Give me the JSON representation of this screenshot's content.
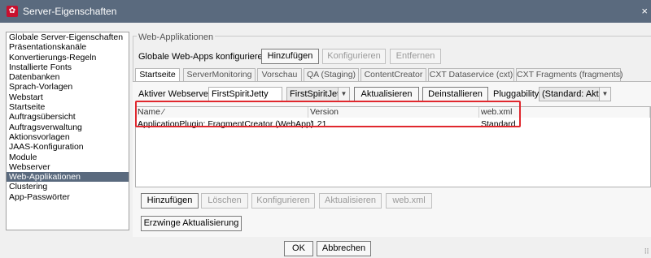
{
  "window": {
    "title": "Server-Eigenschaften",
    "close_glyph": "×",
    "app_icon_glyph": "✿"
  },
  "sidebar": {
    "items": [
      "Globale Server-Eigenschaften",
      "Präsentationskanäle",
      "Konvertierungs-Regeln",
      "Installierte Fonts",
      "Datenbanken",
      "Sprach-Vorlagen",
      "Webstart",
      "Startseite",
      "Auftragsübersicht",
      "Auftragsverwaltung",
      "Aktionsvorlagen",
      "JAAS-Konfiguration",
      "Module",
      "Webserver",
      "Web-Applikationen",
      "Clustering",
      "App-Passwörter"
    ],
    "selected": "Web-Applikationen"
  },
  "webapps": {
    "group_title": "Web-Applikationen",
    "global_label": "Globale Web-Apps konfigurieren:",
    "add_label": "Hinzufügen",
    "configure_label": "Konfigurieren",
    "remove_label": "Entfernen"
  },
  "tabs": [
    "Startseite",
    "ServerMonitoring",
    "Vorschau",
    "QA (Staging)",
    "ContentCreator",
    "CXT Dataservice (cxt)",
    "CXT Fragments (fragments)"
  ],
  "active_tab": "Startseite",
  "webserver": {
    "label": "Aktiver Webserver:",
    "value": "FirstSpiritJetty",
    "combo_value": "FirstSpiritJetty",
    "update_label": "Aktualisieren",
    "uninstall_label": "Deinstallieren",
    "pluggability_label": "Pluggability:",
    "pluggability_value": "(Standard: Aktiv)"
  },
  "table": {
    "headers": [
      "Name ⁄",
      "Version",
      "web.xml"
    ],
    "rows": [
      [
        "ApplicationPlugin: FragmentCreator (WebApp)",
        "1.21",
        "Standard"
      ]
    ]
  },
  "bottom_buttons": {
    "add": "Hinzufügen",
    "delete": "Löschen",
    "configure": "Konfigurieren",
    "update": "Aktualisieren",
    "webxml": "web.xml",
    "force_update": "Erzwinge Aktualisierung"
  },
  "dialog": {
    "ok": "OK",
    "cancel": "Abbrechen"
  },
  "icons": {
    "dropdown_arrow": "▼",
    "resize": "⠿"
  },
  "colors": {
    "titlebar": "#5a6a7e",
    "highlight": "#e0282e",
    "selection": "#5a6a7e"
  }
}
